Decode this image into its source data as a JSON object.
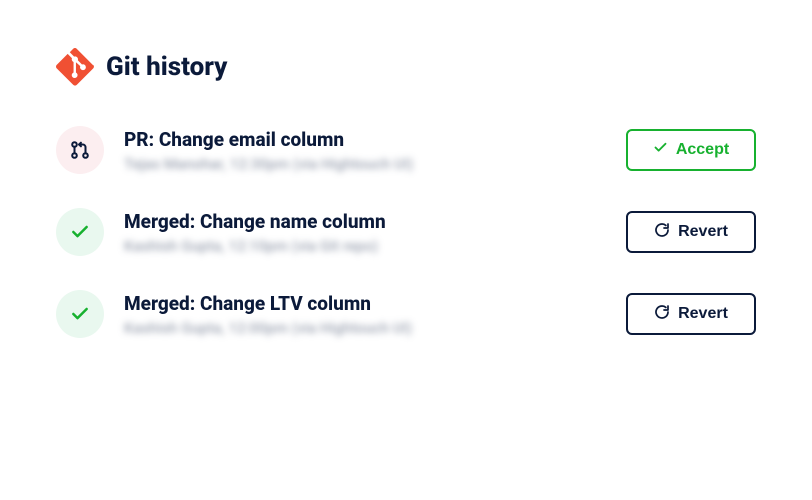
{
  "header": {
    "title": "Git history"
  },
  "history": [
    {
      "status": "pr",
      "title": "PR: Change email column",
      "meta": "Tejas Manohar, 12:30pm (via Hightouch UI)",
      "action": {
        "type": "accept",
        "label": "Accept"
      }
    },
    {
      "status": "merged",
      "title": "Merged: Change name column",
      "meta": "Kashish Gupta, 12:10pm (via Git repo)",
      "action": {
        "type": "revert",
        "label": "Revert"
      }
    },
    {
      "status": "merged",
      "title": "Merged: Change LTV column",
      "meta": "Kashish Gupta, 12:00pm (via Hightouch UI)",
      "action": {
        "type": "revert",
        "label": "Revert"
      }
    }
  ]
}
